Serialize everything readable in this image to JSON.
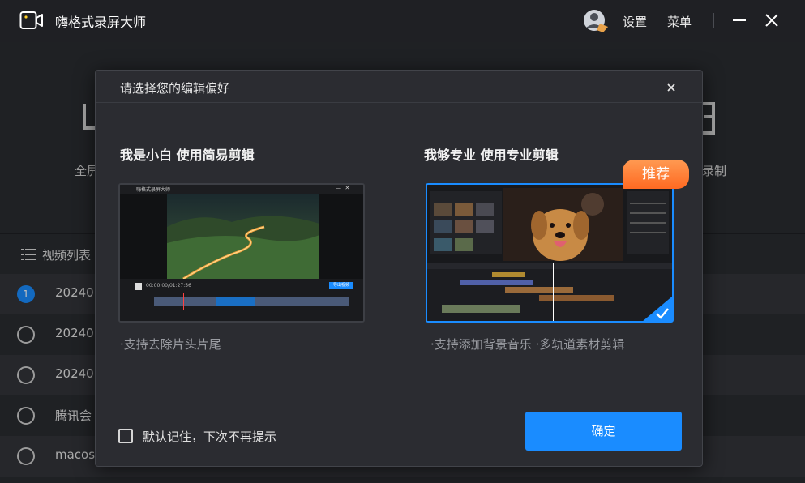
{
  "titlebar": {
    "app_title": "嗨格式录屏大师",
    "settings_label": "设置",
    "menu_label": "菜单"
  },
  "background": {
    "mode_left_label_partial": "全屏",
    "mode_right_label_partial": "录制",
    "list_header_label": "视频列表",
    "rows": [
      {
        "name": "20240",
        "checked": true,
        "index": "1"
      },
      {
        "name": "20240",
        "checked": false
      },
      {
        "name": "20240",
        "checked": false
      },
      {
        "name": "腾讯会",
        "checked": false
      },
      {
        "name": "macos",
        "checked": false
      }
    ]
  },
  "dialog": {
    "title": "请选择您的编辑偏好",
    "option_simple": {
      "title": "我是小白 使用简易剪辑",
      "description": "·支持去除片头片尾",
      "preview_app_title": "嗨格式录屏大师",
      "preview_timecode": "00:00:00/01:27:56",
      "preview_export_label": "导出视频"
    },
    "option_pro": {
      "title": "我够专业 使用专业剪辑",
      "description": "·支持添加背景音乐 ·多轨道素材剪辑",
      "badge": "推荐",
      "selected": true
    },
    "remember_label": "默认记住，下次不再提示",
    "confirm_label": "确定"
  },
  "colors": {
    "accent": "#1a8cff",
    "badge_start": "#ff9a52",
    "badge_end": "#ff6a22",
    "dialog_bg": "#2b2c31",
    "titlebar_bg": "#1f2024"
  }
}
